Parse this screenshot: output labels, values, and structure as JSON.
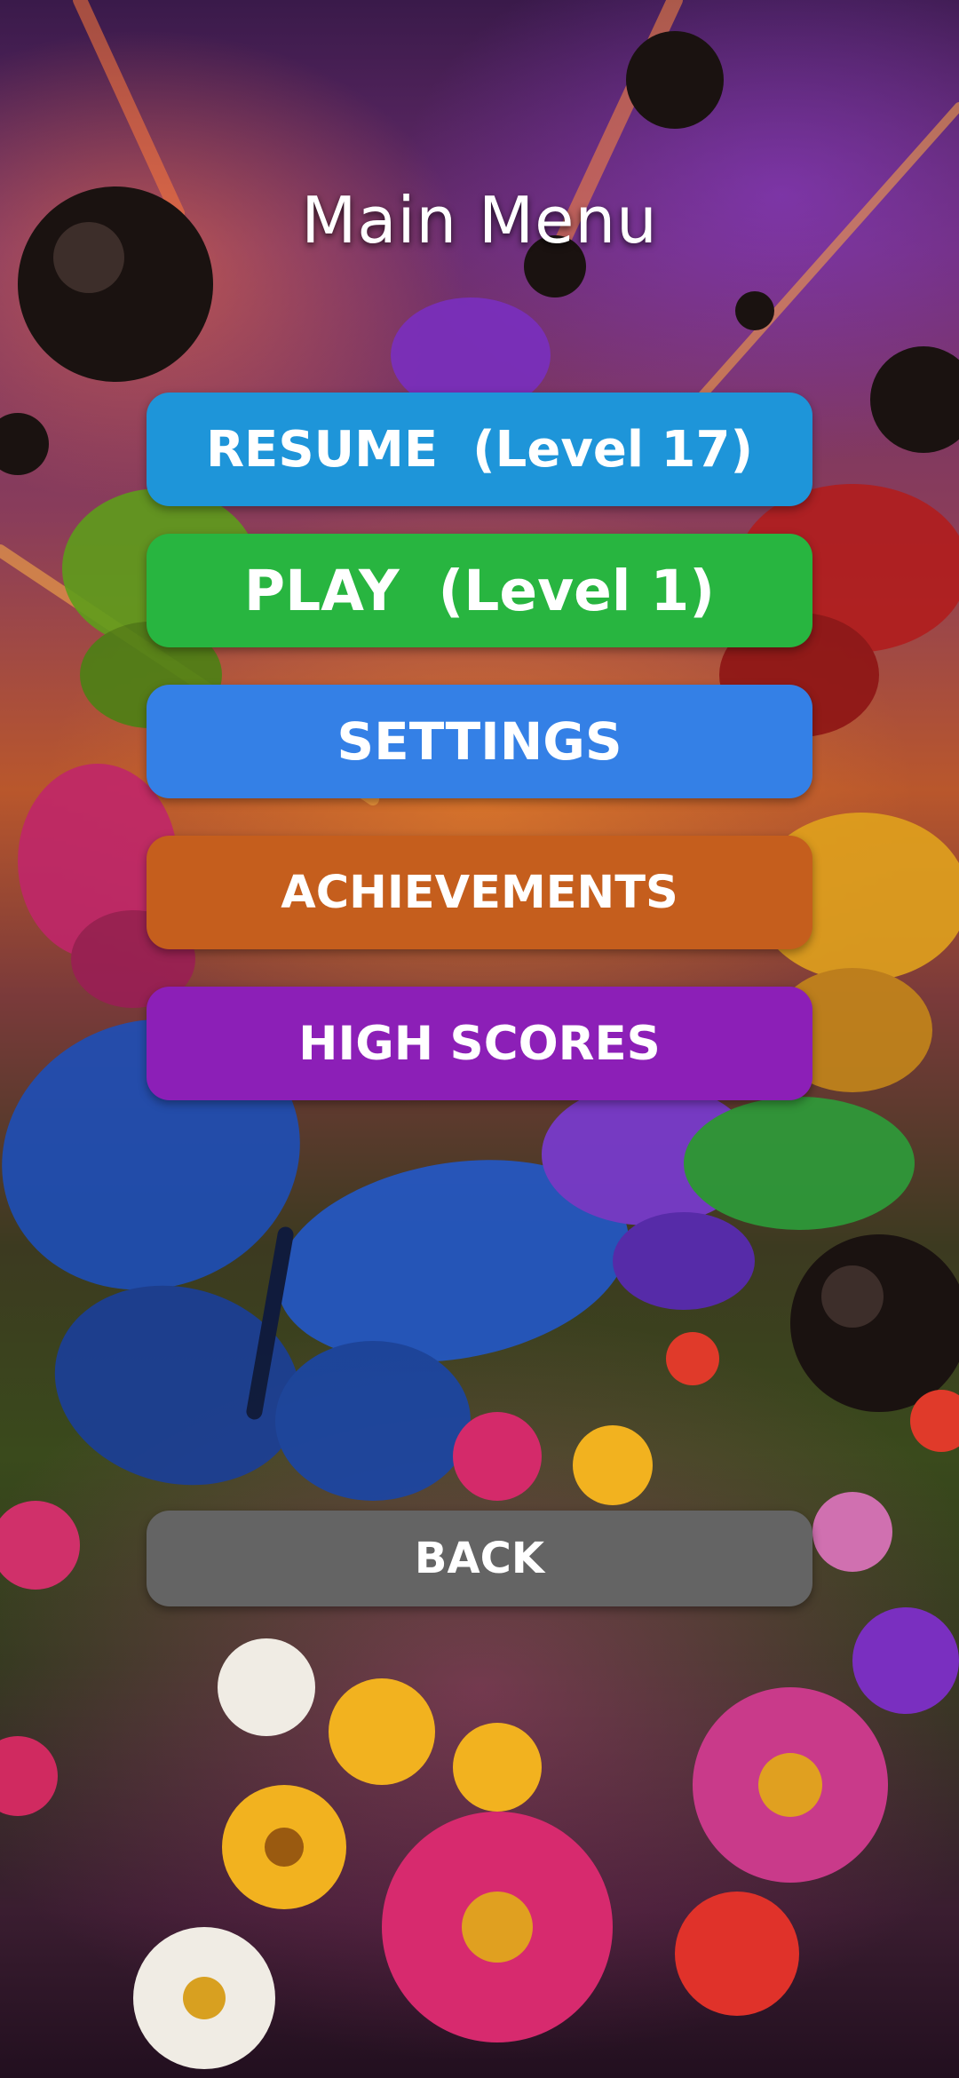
{
  "menu": {
    "title": "Main Menu",
    "buttons": {
      "resume": "RESUME  (Level 17)",
      "play": "PLAY  (Level 1)",
      "settings": "SETTINGS",
      "achievements": "ACHIEVEMENTS",
      "high_scores": "HIGH SCORES",
      "back": "BACK"
    }
  },
  "colors": {
    "resume": "#1e95d9",
    "play": "#28b540",
    "settings": "#3480e6",
    "achievements": "#c55e1d",
    "high_scores": "#8c1fb7",
    "back": "#646464"
  },
  "background": {
    "description_icons": [
      "meteor",
      "butterfly",
      "flower"
    ]
  }
}
